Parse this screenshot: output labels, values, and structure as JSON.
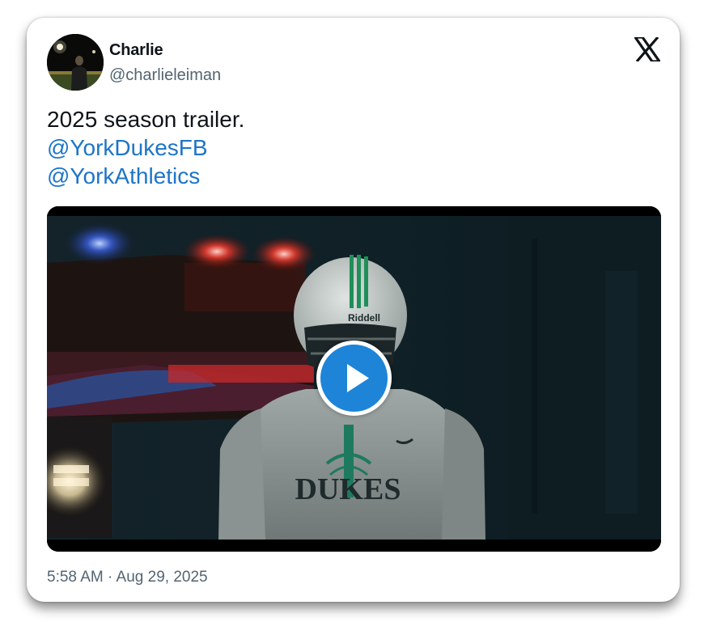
{
  "tweet": {
    "author": {
      "display_name": "Charlie",
      "handle": "@charlieleiman",
      "avatar_icon": "profile-photo-icon"
    },
    "brand_icon": "x-logo-icon",
    "text_lines": [
      "2025 season trailer."
    ],
    "mentions": [
      "@YorkDukesFB",
      "@YorkAthletics"
    ],
    "media": {
      "type": "video",
      "play_icon": "play-icon",
      "jersey_text": "DUKES",
      "helmet_brand": "Riddell"
    },
    "timestamp": "5:58 AM · Aug 29, 2025"
  },
  "colors": {
    "text_primary": "#0f1419",
    "text_secondary": "#536471",
    "link": "#1d75c9",
    "play_button": "#1d84d8"
  }
}
